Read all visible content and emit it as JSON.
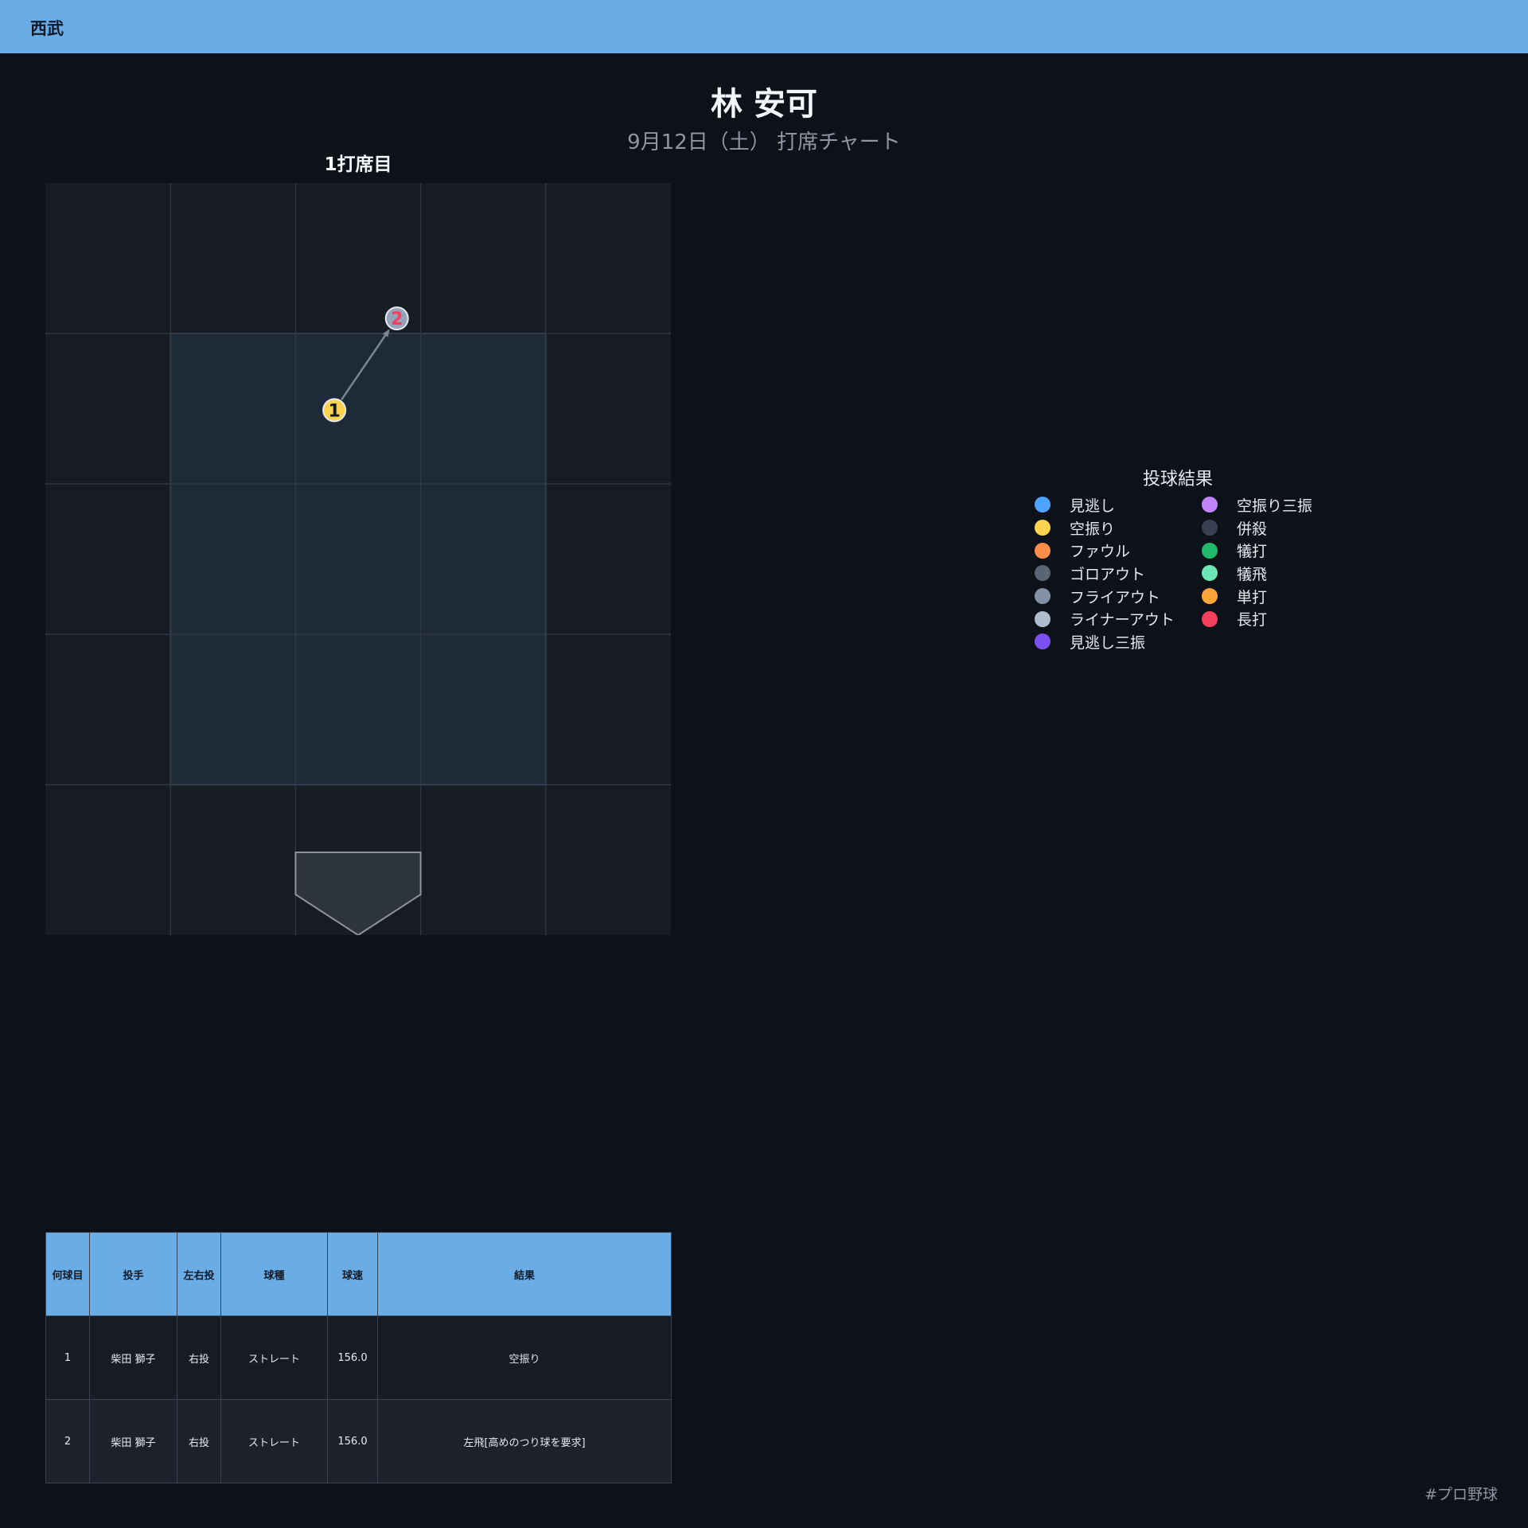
{
  "header": {
    "team": "西武"
  },
  "player": {
    "name": "林 安可",
    "subtitle": "9月12日（土） 打席チャート"
  },
  "chart_data": {
    "type": "scatter",
    "title": "1打席目",
    "grid_cols": 5,
    "grid_rows": 5,
    "strike_zone": {
      "cols": [
        1,
        4
      ],
      "rows": [
        1,
        4
      ]
    },
    "pitches": [
      {
        "num": "1",
        "x": 2.31,
        "y": 1.51,
        "result": "空振り",
        "color": "#fcd34d"
      },
      {
        "num": "2",
        "x": 2.81,
        "y": 0.9,
        "result": "左飛[高めのつり球を要求]",
        "color": "#94a3b8"
      }
    ]
  },
  "legend": {
    "title": "投球結果",
    "items": [
      {
        "label": "見逃し",
        "color": "#4da3ff"
      },
      {
        "label": "空振り三振",
        "color": "#c084fc"
      },
      {
        "label": "空振り",
        "color": "#fcd34d"
      },
      {
        "label": "併殺",
        "color": "#374151"
      },
      {
        "label": "ファウル",
        "color": "#fb8c4a"
      },
      {
        "label": "犠打",
        "color": "#22b86a"
      },
      {
        "label": "ゴロアウト",
        "color": "#5a6573"
      },
      {
        "label": "犠飛",
        "color": "#6ee7b7"
      },
      {
        "label": "フライアウト",
        "color": "#8391a6"
      },
      {
        "label": "単打",
        "color": "#fba63a"
      },
      {
        "label": "ライナーアウト",
        "color": "#b0bccb"
      },
      {
        "label": "長打",
        "color": "#f43f5e"
      },
      {
        "label": "見逃し三振",
        "color": "#7c4ff0"
      }
    ]
  },
  "table": {
    "headers": [
      "何球目",
      "投手",
      "左右投",
      "球種",
      "球速",
      "結果"
    ],
    "rows": [
      [
        "1",
        "柴田 獅子",
        "右投",
        "ストレート",
        "156.0",
        "空振り"
      ],
      [
        "2",
        "柴田 獅子",
        "右投",
        "ストレート",
        "156.0",
        "左飛[高めのつり球を要求]"
      ]
    ]
  },
  "footer": {
    "hashtag": "#プロ野球"
  }
}
